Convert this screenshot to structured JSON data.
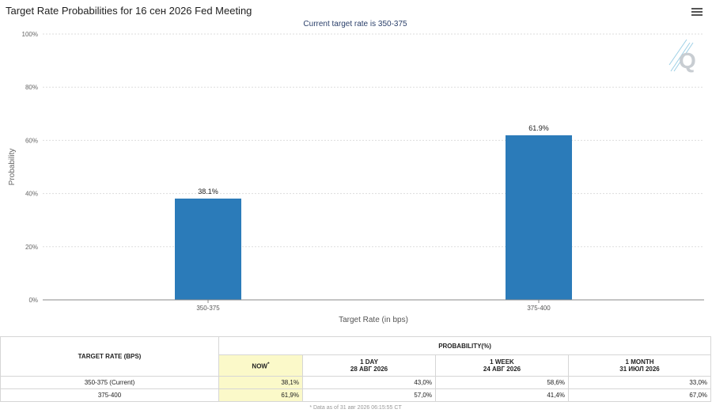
{
  "window": {
    "title": "Target Rate Probabilities for 16 сен 2026 Fed Meeting",
    "subtitle": "Current target rate is 350-375",
    "menu_icon": "hamburger-menu-icon",
    "watermark_icon": "q-logo-icon"
  },
  "chart_data": {
    "type": "bar",
    "title": "Target Rate Probabilities for 16 сен 2026 Fed Meeting",
    "subtitle": "Current target rate is 350-375",
    "categories": [
      "350-375",
      "375-400"
    ],
    "values": [
      38.1,
      61.9
    ],
    "value_labels": [
      "38.1%",
      "61.9%"
    ],
    "xlabel": "Target Rate (in bps)",
    "ylabel": "Probability",
    "ylim": [
      0,
      100
    ],
    "yticks": [
      0,
      20,
      40,
      60,
      80,
      100
    ],
    "ytick_labels": [
      "0%",
      "20%",
      "40%",
      "60%",
      "80%",
      "100%"
    ],
    "grid": "horizontal dashed",
    "bar_color": "#2b7bb9"
  },
  "table": {
    "header_target": "TARGET RATE (BPS)",
    "header_probability": "PROBABILITY(%)",
    "cols": [
      {
        "label": "NOW",
        "sup": "*",
        "date": ""
      },
      {
        "label": "1 DAY",
        "sup": "",
        "date": "28 АВГ 2026"
      },
      {
        "label": "1 WEEK",
        "sup": "",
        "date": "24 АВГ 2026"
      },
      {
        "label": "1 MONTH",
        "sup": "",
        "date": "31 ИЮЛ 2026"
      }
    ],
    "rows": [
      {
        "rate": "350-375 (Current)",
        "values": [
          "38,1%",
          "43,0%",
          "58,6%",
          "33,0%"
        ]
      },
      {
        "rate": "375-400",
        "values": [
          "61,9%",
          "57,0%",
          "41,4%",
          "67,0%"
        ]
      }
    ],
    "note": "* Data as of 31 авг 2026 06:15:55 CT"
  }
}
